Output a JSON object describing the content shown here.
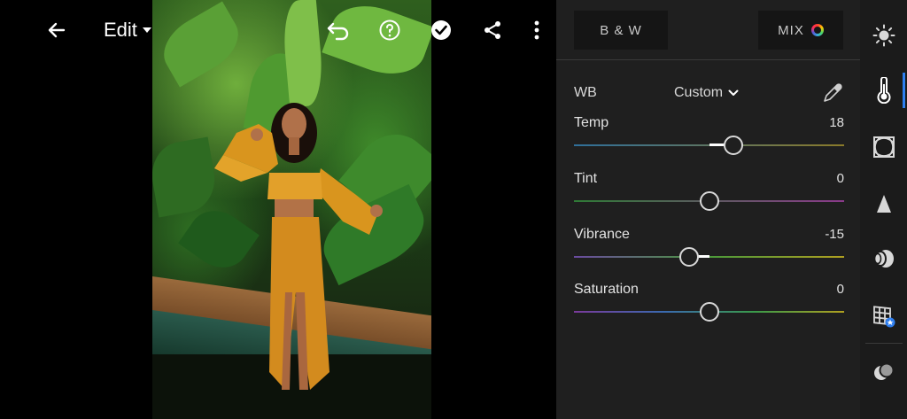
{
  "topbar": {
    "edit_label": "Edit",
    "icons": [
      "back-arrow-icon",
      "undo-icon",
      "help-icon",
      "done-check-icon",
      "share-icon",
      "more-vertical-icon"
    ]
  },
  "panel": {
    "bw_label": "B & W",
    "mix_label": "MIX",
    "wb": {
      "label": "WB",
      "value": "Custom"
    },
    "sliders": [
      {
        "label": "Temp",
        "value": "18",
        "position": 0.59,
        "colors": [
          "#2f6f9a",
          "#8a7a2a"
        ]
      },
      {
        "label": "Tint",
        "value": "0",
        "position": 0.5,
        "colors": [
          "#2f7a36",
          "#8a3a8a"
        ]
      },
      {
        "label": "Vibrance",
        "value": "-15",
        "position": 0.425,
        "colors": [
          "#6a4aa0",
          "#4a9a3a",
          "#b0a020"
        ]
      },
      {
        "label": "Saturation",
        "value": "0",
        "position": 0.5,
        "colors": [
          "#7a3a9a",
          "#3a6ab0",
          "#3a9a4a",
          "#b0a020"
        ]
      }
    ]
  },
  "rail": {
    "icons": [
      "light-icon",
      "color-temperature-icon",
      "effects-icon",
      "detail-icon",
      "optics-icon",
      "geometry-icon",
      "presets-icon"
    ],
    "active": "color-temperature-icon"
  },
  "colors": {
    "panel_bg": "#1f1f1f",
    "rail_bg": "#1b1b1b",
    "accent": "#2f7ff0"
  }
}
